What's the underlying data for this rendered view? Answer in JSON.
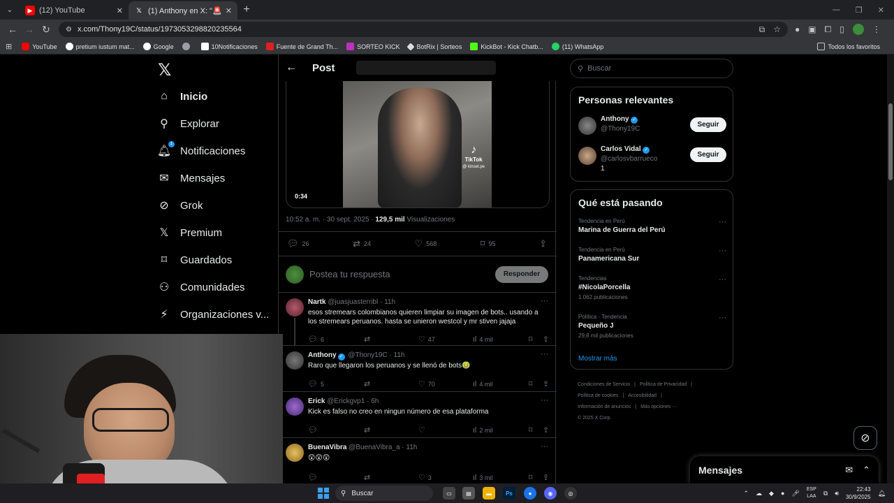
{
  "browser": {
    "tabs": [
      {
        "title": "(12) YouTube",
        "active": false
      },
      {
        "title": "(1) Anthony en X: \"🚨 BOMBA",
        "active": true
      }
    ],
    "url": "x.com/Thony19C/status/1973053298820235564",
    "bookmarks": [
      "YouTube",
      "pretium iustum mat...",
      "Google",
      "",
      "10Notificaciones",
      "Fuente de Grand Th...",
      "SORTEO KICK",
      "BotRix | Sorteos",
      "KickBot - Kick Chatb...",
      "(11) WhatsApp"
    ],
    "all_bookmarks": "Todos los favoritos"
  },
  "nav": {
    "items": [
      {
        "label": "Inicio",
        "icon": "home-icon"
      },
      {
        "label": "Explorar",
        "icon": "search-icon"
      },
      {
        "label": "Notificaciones",
        "icon": "bell-icon"
      },
      {
        "label": "Mensajes",
        "icon": "mail-icon"
      },
      {
        "label": "Grok",
        "icon": "grok-icon"
      },
      {
        "label": "Premium",
        "icon": "x-logo-icon"
      },
      {
        "label": "Guardados",
        "icon": "bookmark-icon"
      },
      {
        "label": "Comunidades",
        "icon": "communities-icon"
      },
      {
        "label": "Organizaciones v...",
        "icon": "lightning-icon"
      }
    ],
    "notif_badge": "1"
  },
  "post": {
    "header": "Post",
    "duration": "0:34",
    "tiktok_label": "TikTok",
    "tiktok_user": "@ kinset.pe",
    "time": "10:52 a. m. · 30 sept. 2025 ·",
    "views": "129,5 mil",
    "views_label": "Visualizaciones",
    "replies": "26",
    "reposts": "24",
    "likes": "568",
    "bookmarks": "95",
    "reply_placeholder": "Postea tu respuesta",
    "reply_button": "Responder"
  },
  "replies": [
    {
      "name": "Nartk",
      "handle": "@juasjuasterribl · 11h",
      "verified": false,
      "text": "esos stremears colombianos quieren limpiar su imagen de bots.. usando a los stremears peruanos. hasta se unieron westcol y mr stiven jajaja",
      "replies": "6",
      "reposts": "",
      "likes": "47",
      "views": "4 mil"
    },
    {
      "name": "Anthony",
      "handle": "@Thony19C · 11h",
      "verified": true,
      "text": "Raro que llegaron los peruanos y se llenó de bots🤢",
      "replies": "5",
      "reposts": "",
      "likes": "70",
      "views": "4 mil"
    },
    {
      "name": "Erick",
      "handle": "@Erickgvp1 · 6h",
      "verified": false,
      "text": "Kick es falso no creo en ningun número de esa plataforma",
      "replies": "",
      "reposts": "",
      "likes": "",
      "views": "2 mil"
    },
    {
      "name": "BuenaVibra",
      "handle": "@BuenaVibra_a · 11h",
      "verified": false,
      "text": "😲😲😲",
      "replies": "",
      "reposts": "",
      "likes": "3",
      "views": "3 mil"
    }
  ],
  "right": {
    "search_placeholder": "Buscar",
    "relevant_title": "Personas relevantes",
    "users": [
      {
        "name": "Anthony",
        "handle": "@Thony19C",
        "extra": "",
        "button": "Seguir"
      },
      {
        "name": "Carlos Vidal",
        "handle": "@carlosvbarrueco",
        "extra": "1",
        "button": "Seguir"
      }
    ],
    "trends_title": "Qué está pasando",
    "trends": [
      {
        "category": "Tendencia en Perú",
        "name": "Marina de Guerra del Perú",
        "count": ""
      },
      {
        "category": "Tendencia en Perú",
        "name": "Panamericana Sur",
        "count": ""
      },
      {
        "category": "Tendencias",
        "name": "#NicolaPorcella",
        "count": "1.062 publicaciones"
      },
      {
        "category": "Política · Tendencia",
        "name": "Pequeño J",
        "count": "29,8 mil publicaciones"
      }
    ],
    "show_more": "Mostrar más",
    "footer": [
      "Condiciones de Servicio",
      "|",
      "Política de Privacidad",
      "|",
      "Política de cookies",
      "|",
      "Accesibilidad",
      "|",
      "Información de anuncios",
      "|",
      "Más opciones ···",
      "© 2025 X Corp."
    ]
  },
  "messages_drawer": "Mensajes",
  "taskbar": {
    "search": "Buscar",
    "lang_top": "ESP",
    "lang_bottom": "LAA",
    "time": "22:43",
    "date": "30/9/2025"
  },
  "colors": {
    "accent": "#1d9bf0",
    "bg": "#000000",
    "border": "#2f3336",
    "muted": "#71767b"
  }
}
